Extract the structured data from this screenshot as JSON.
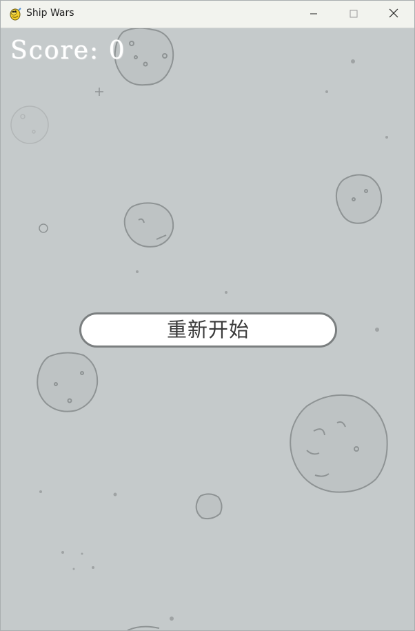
{
  "window": {
    "title": "Ship Wars",
    "app_icon": "pygame-snake-icon",
    "controls": {
      "minimize_icon": "minimize-icon",
      "maximize_icon": "maximize-icon",
      "close_icon": "close-icon"
    }
  },
  "game": {
    "score_text": "Score: 0",
    "restart_button_label": "重新开始",
    "background_color": "#c5cacb",
    "asteroid_color": "#9fa3a4"
  }
}
